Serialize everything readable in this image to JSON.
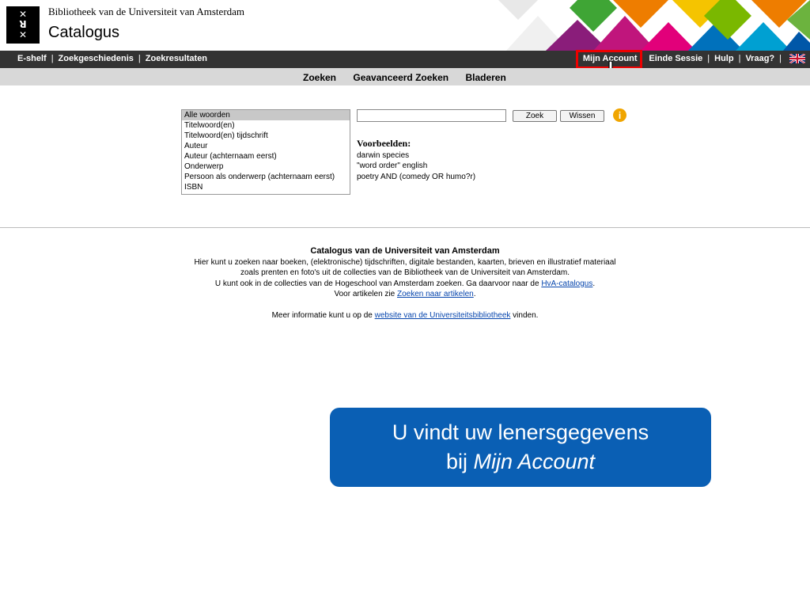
{
  "header": {
    "logo_lines": [
      "✕",
      "ꓤ",
      "✕"
    ],
    "library_name": "Bibliotheek van de Universiteit van Amsterdam",
    "catalog_title": "Catalogus"
  },
  "topnav": {
    "left_items": [
      "E-shelf",
      "Zoekgeschiedenis",
      "Zoekresultaten"
    ],
    "right_items": [
      "Mijn Account",
      "Einde Sessie",
      "Hulp",
      "Vraag?"
    ],
    "separator": "|",
    "flag_icon": "uk-flag-icon"
  },
  "subnav": {
    "items": [
      "Zoeken",
      "Geavanceerd Zoeken",
      "Bladeren"
    ]
  },
  "search": {
    "fields": [
      "Alle woorden",
      "Titelwoord(en)",
      "Titelwoord(en) tijdschrift",
      "Auteur",
      "Auteur (achternaam eerst)",
      "Onderwerp",
      "Persoon als onderwerp (achternaam eerst)",
      "ISBN"
    ],
    "selected_field": "Alle woorden",
    "query_value": "",
    "zoek_label": "Zoek",
    "wissen_label": "Wissen",
    "info_icon_glyph": "i",
    "examples_title": "Voorbeelden:",
    "examples": [
      "darwin species",
      "\"word order\" english",
      "poetry AND (comedy OR humo?r)"
    ]
  },
  "info": {
    "title": "Catalogus van de Universiteit van Amsterdam",
    "line1": "Hier kunt u zoeken naar boeken, (elektronische) tijdschriften, digitale bestanden, kaarten, brieven en illustratief materiaal",
    "line2": "zoals prenten en foto's uit de collecties van de Bibliotheek van de Universiteit van Amsterdam.",
    "line3_pre": "U kunt ook in de collecties van de Hogeschool van Amsterdam zoeken. Ga daarvoor naar de ",
    "line3_link": "HvA-catalogus",
    "line3_post": ".",
    "line4_pre": "Voor artikelen zie ",
    "line4_link": "Zoeken naar artikelen",
    "line4_post": ".",
    "line5_pre": "Meer informatie kunt u op de ",
    "line5_link": "website van de Universiteitsbibliotheek",
    "line5_post": " vinden."
  },
  "callout": {
    "line1": "U vindt uw lenersgegevens",
    "line2_pre": "bij ",
    "line2_em": "Mijn Account"
  },
  "colors": {
    "topnav_bg": "#333333",
    "subnav_bg": "#d8d8d8",
    "highlight_border": "#ee0000",
    "callout_bg": "#0a5fb4",
    "info_icon": "#f0a500"
  }
}
